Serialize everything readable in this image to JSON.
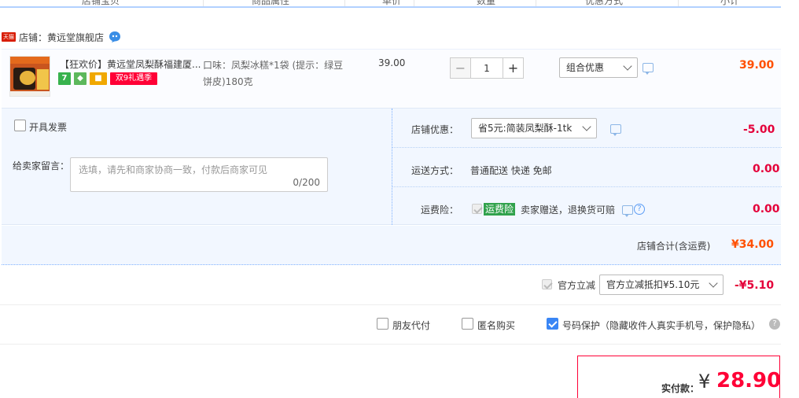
{
  "header": {
    "columns": [
      "店铺宝贝",
      "商品属性",
      "单价",
      "数量",
      "优惠方式",
      "小计"
    ]
  },
  "shop": {
    "badge": "天猫",
    "label": "店铺：黄远堂旗舰店"
  },
  "item": {
    "title": "【狂欢价】黄远堂凤梨酥福建厦...",
    "tag_7": "7",
    "tag_promo": "双9礼遇季",
    "attr": "口味：凤梨冰糕*1袋 (提示：绿豆饼皮)180克",
    "price": "39.00",
    "quantity": "1",
    "discount_select": "组合优惠",
    "subtotal": "39.00"
  },
  "options": {
    "invoice_label": "开具发票",
    "memo_label": "给卖家留言：",
    "memo_placeholder": "选填，请先和商家协商一致，付款后商家可见",
    "memo_count": "0/200",
    "store_discount_label": "店铺优惠：",
    "store_discount_select": "省5元:简装凤梨酥-1tk",
    "store_discount_amount": "-5.00",
    "shipping_label": "运送方式：",
    "shipping_value": "普通配送 快递 免邮",
    "shipping_amount": "0.00",
    "insurance_label": "运费险：",
    "insurance_badge": "运费险",
    "insurance_text": "卖家赠送，退换货可赔",
    "insurance_amount": "0.00"
  },
  "store_total": {
    "label": "店铺合计(含运费)",
    "amount": "¥34.00"
  },
  "platform": {
    "label": "官方立减",
    "select": "官方立减抵扣¥5.10元",
    "amount": "-¥5.10"
  },
  "pay_options": {
    "friend_pay": "朋友代付",
    "anonymous": "匿名购买",
    "privacy": "号码保护（隐藏收件人真实手机号，保护隐私）"
  },
  "payment": {
    "label": "实付款：",
    "currency": "¥",
    "amount": "28.90"
  },
  "colors": {
    "accent_orange": "#ff5000",
    "accent_red": "#e4003a",
    "options_bg": "#f2f7ff",
    "checkbox_blue": "#3a86f5"
  }
}
